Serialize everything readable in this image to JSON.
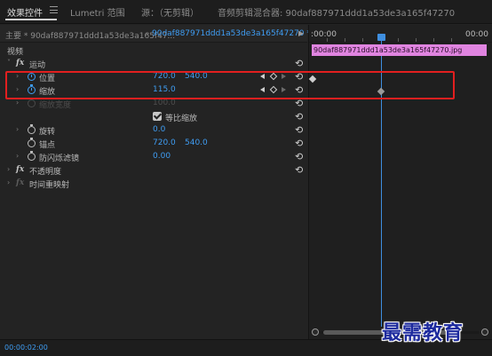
{
  "tabs": [
    {
      "label": "效果控件"
    },
    {
      "label": "Lumetri 范围"
    },
    {
      "label": "源：（无剪辑）"
    },
    {
      "label": "音频剪辑混合器: 90daf887971ddd1a53de3a165f47270"
    }
  ],
  "source": {
    "main": "主要 * 90daf887971ddd1a53de3a165f47...",
    "clip": "90daf887971ddd1a53de3a165f47270 *..."
  },
  "sections": {
    "video": "视频",
    "motion": "运动",
    "opacity": "不透明度",
    "time_remap": "时间重映射"
  },
  "fx_icon": "fx",
  "properties": {
    "position": {
      "label": "位置",
      "x": "720.0",
      "y": "540.0"
    },
    "scale": {
      "label": "缩放",
      "value": "115.0"
    },
    "scale_width": {
      "label": "缩放宽度",
      "value": "100.0"
    },
    "uniform_scale": {
      "label": "等比缩放"
    },
    "rotation": {
      "label": "旋转",
      "value": "0.0"
    },
    "anchor": {
      "label": "锚点",
      "x": "720.0",
      "y": "540.0"
    },
    "anti_flicker": {
      "label": "防闪烁滤镜",
      "value": "0.00"
    }
  },
  "timeline": {
    "ruler_start": ":00:00",
    "ruler_end": "00:00",
    "clip_name": "90daf887971ddd1a53de3a165f47270.jpg"
  },
  "status": {
    "timecode": "00:00:02:00"
  },
  "watermark": "最需教育",
  "icons": {
    "reset": "⟲",
    "twirl_open": "˅",
    "twirl_closed": "›",
    "play": "▶",
    "chevron": "⌄"
  },
  "colors": {
    "accent": "#3f9df3",
    "clip": "#e084e0",
    "highlight": "#e21f1f"
  }
}
